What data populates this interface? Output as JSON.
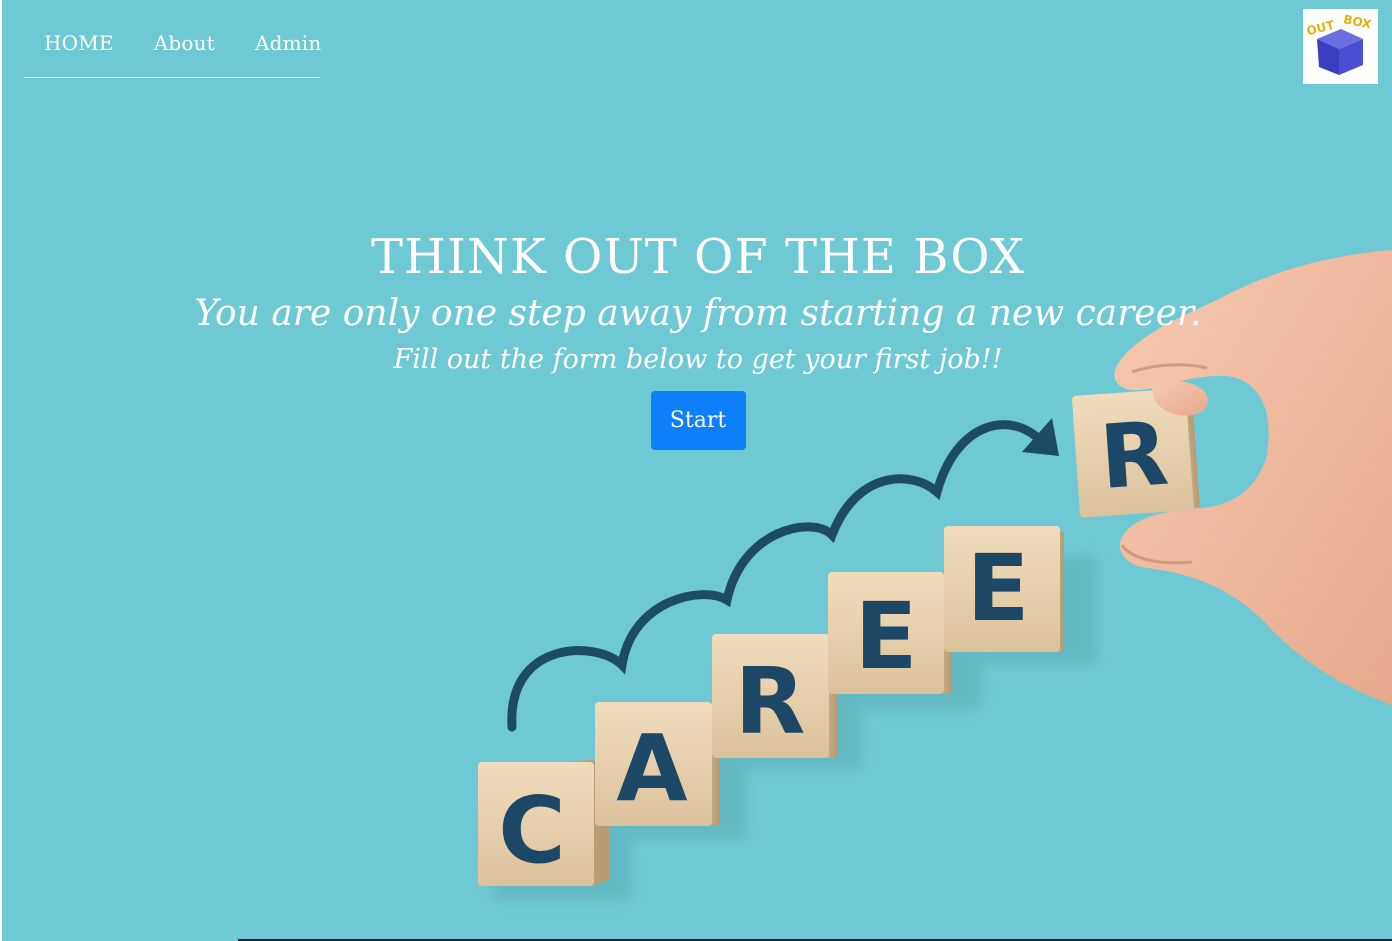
{
  "nav": {
    "items": [
      {
        "label": "HOME"
      },
      {
        "label": "About"
      },
      {
        "label": "Admin"
      }
    ]
  },
  "logo": {
    "word_out": "OUT",
    "word_box": "BOX"
  },
  "hero": {
    "title": "THINK OUT OF THE BOX",
    "subtitle": "You are only one step away from starting a new career.",
    "tagline": "Fill out the form below to get your first job!!",
    "start_label": "Start"
  },
  "illustration": {
    "letters": [
      "C",
      "A",
      "R",
      "E",
      "E",
      "R"
    ]
  },
  "colors": {
    "background": "#6fc9d4",
    "button": "#0d7ff9",
    "letters": "#1c4766",
    "block": "#ecd6b5"
  }
}
